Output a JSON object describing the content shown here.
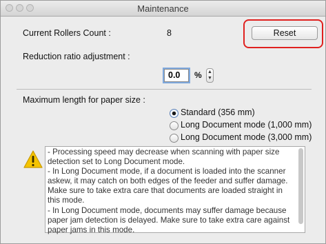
{
  "window": {
    "title": "Maintenance"
  },
  "rollers": {
    "label": "Current Rollers Count :",
    "value": "8",
    "reset_label": "Reset"
  },
  "reduction": {
    "label": "Reduction ratio adjustment :",
    "value": "0.0",
    "unit": "%"
  },
  "paper": {
    "label": "Maximum length for paper size :",
    "options": [
      {
        "label": "Standard (356 mm)",
        "selected": true
      },
      {
        "label": "Long Document mode (1,000 mm)",
        "selected": false
      },
      {
        "label": "Long Document mode (3,000 mm)",
        "selected": false
      }
    ]
  },
  "notes": {
    "text": "- Processing speed may decrease when scanning with paper size detection set to Long Document mode.\n- In Long Document mode, if a document is loaded into the scanner askew, it may catch on both edges of the feeder and suffer damage. Make sure to take extra care that documents are loaded straight in this mode.\n- In Long Document mode, documents may suffer damage because paper jam detection is delayed. Make sure to take extra care against paper jams in this mode."
  },
  "colors": {
    "highlight": "#e0201e",
    "warning": "#f5c400",
    "focus": "#7fa9de"
  },
  "icons": [
    "close-icon",
    "minimize-icon",
    "zoom-icon",
    "stepper-icon",
    "warning-icon"
  ]
}
